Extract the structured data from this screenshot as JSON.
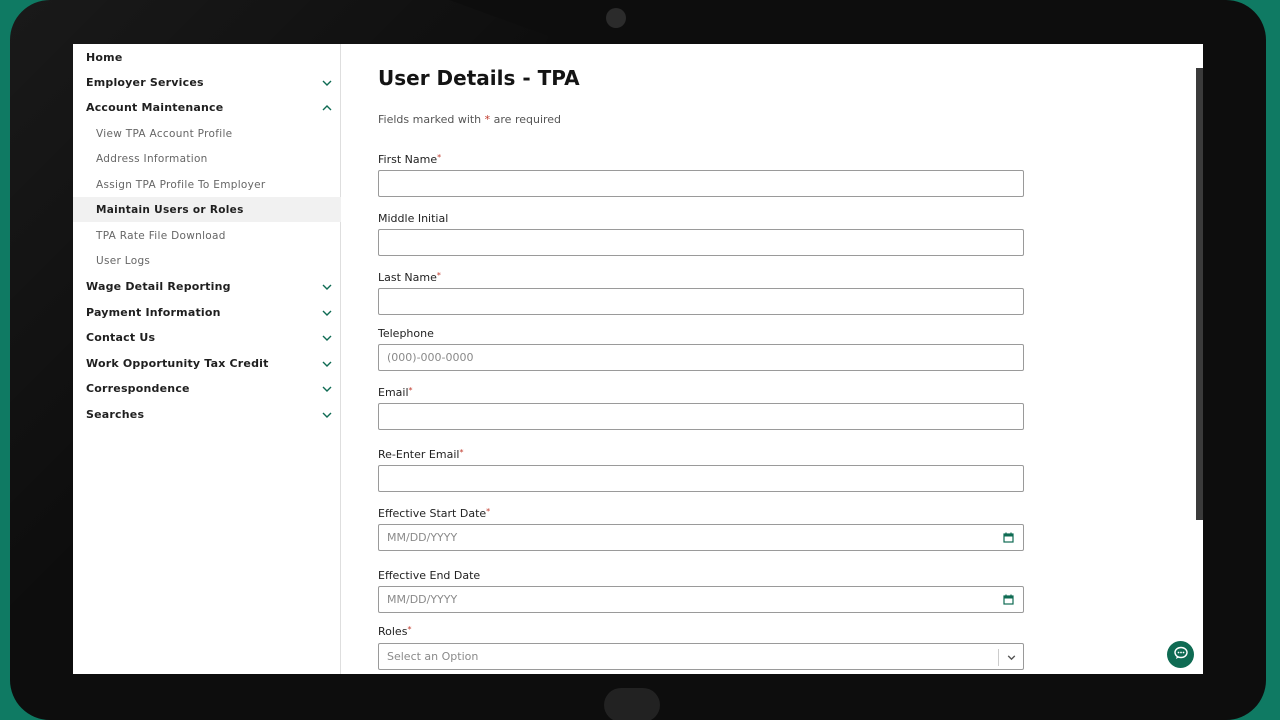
{
  "sidebar": {
    "items": [
      {
        "label": "Home",
        "expandable": false
      },
      {
        "label": "Employer Services",
        "expandable": true,
        "expanded": false
      },
      {
        "label": "Account Maintenance",
        "expandable": true,
        "expanded": true
      },
      {
        "label": "Wage Detail Reporting",
        "expandable": true,
        "expanded": false
      },
      {
        "label": "Payment Information",
        "expandable": true,
        "expanded": false
      },
      {
        "label": "Contact Us",
        "expandable": true,
        "expanded": false
      },
      {
        "label": "Work Opportunity Tax Credit",
        "expandable": true,
        "expanded": false
      },
      {
        "label": "Correspondence",
        "expandable": true,
        "expanded": false
      },
      {
        "label": "Searches",
        "expandable": true,
        "expanded": false
      }
    ],
    "account_maintenance_subitems": [
      {
        "label": "View TPA Account Profile"
      },
      {
        "label": "Address Information"
      },
      {
        "label": "Assign TPA Profile To Employer"
      },
      {
        "label": "Maintain Users or Roles",
        "active": true
      },
      {
        "label": "TPA Rate File Download"
      },
      {
        "label": "User Logs"
      }
    ]
  },
  "main": {
    "title": "User Details - TPA",
    "required_note_prefix": "Fields marked with ",
    "required_star": "*",
    "required_note_suffix": " are required",
    "fields": [
      {
        "label": "First Name",
        "required": true,
        "value": "",
        "placeholder": ""
      },
      {
        "label": "Middle Initial",
        "required": false,
        "value": "",
        "placeholder": ""
      },
      {
        "label": "Last Name",
        "required": true,
        "value": "",
        "placeholder": ""
      },
      {
        "label": "Telephone",
        "required": false,
        "value": "",
        "placeholder": "(000)-000-0000"
      },
      {
        "label": "Email",
        "required": true,
        "value": "",
        "placeholder": ""
      },
      {
        "label": "Re-Enter Email",
        "required": true,
        "value": "",
        "placeholder": ""
      },
      {
        "label": "Effective Start Date",
        "required": true,
        "value": "",
        "placeholder": "MM/DD/YYYY",
        "icon": "calendar-icon"
      },
      {
        "label": "Effective End Date",
        "required": false,
        "value": "",
        "placeholder": "MM/DD/YYYY",
        "icon": "calendar-icon"
      },
      {
        "label": "Roles",
        "required": true,
        "value": "",
        "placeholder": "Select an Option",
        "icon": "chevron-down-icon"
      }
    ]
  },
  "colors": {
    "brand_green": "#0f6b53",
    "background_green": "#0f7a63",
    "required_red": "#c0392b"
  }
}
